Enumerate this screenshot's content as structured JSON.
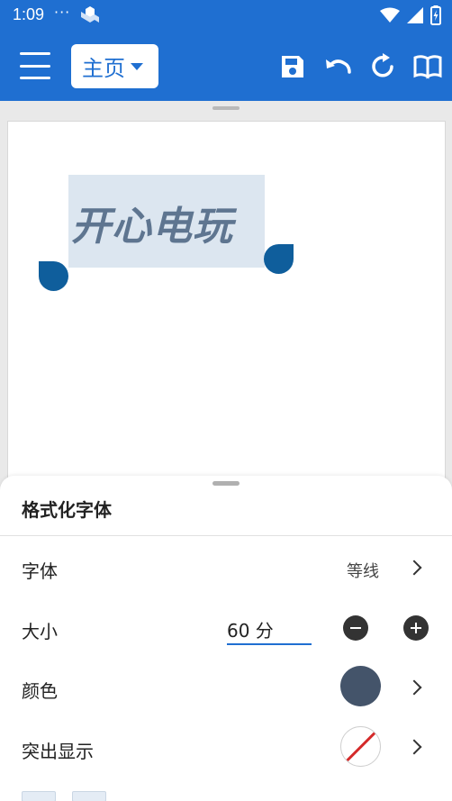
{
  "status_bar": {
    "time": "1:09",
    "dots": "···",
    "icons": [
      "app-notification-icon",
      "wifi-icon",
      "signal-icon",
      "battery-icon"
    ]
  },
  "toolbar": {
    "tab_label": "主页",
    "icons": [
      "menu-icon",
      "save-icon",
      "undo-icon",
      "redo-icon",
      "read-mode-icon"
    ],
    "color": "#1f6fd1"
  },
  "document": {
    "selected_text": "开心电玩",
    "selection_color": "#dce6f0",
    "text_color": "#5e7590",
    "handle_color": "#0f5e9c"
  },
  "format_sheet": {
    "title": "格式化字体",
    "font": {
      "label": "字体",
      "value": "等线"
    },
    "size": {
      "label": "大小",
      "value": "60 分"
    },
    "color": {
      "label": "颜色",
      "swatch": "#44546a"
    },
    "highlight": {
      "label": "突出显示",
      "swatch": "none"
    }
  }
}
